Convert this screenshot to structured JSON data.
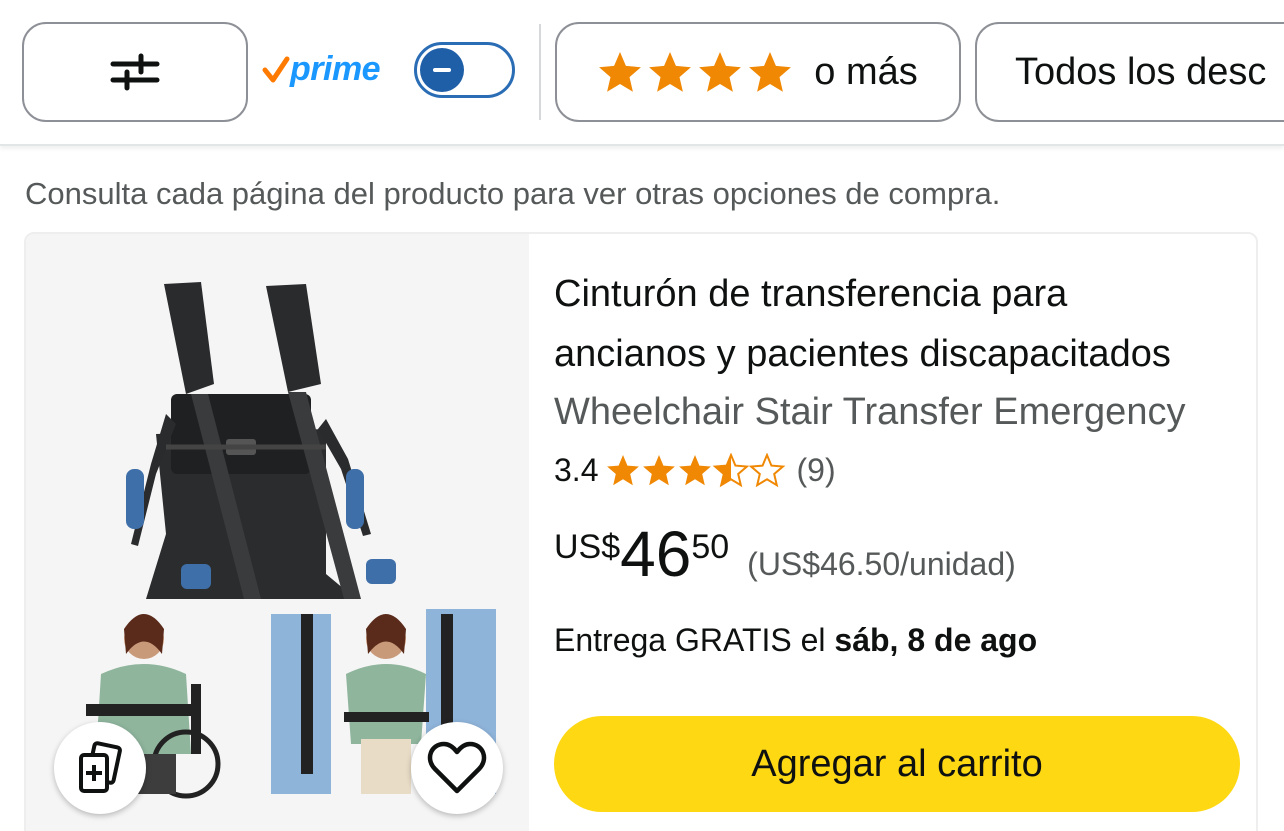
{
  "filter_bar": {
    "filter_icon": "sliders-icon",
    "prime_label": "prime",
    "prime_check_icon": "check-icon",
    "prime_toggle": {
      "on": false,
      "icon": "minus-icon"
    },
    "stars_filter": {
      "stars": 4,
      "label": "o más",
      "star_color": "#f08804"
    },
    "discount_filter": {
      "label": "Todos los desc"
    }
  },
  "notice": "Consulta cada página del producto para ver otras opciones de compra.",
  "product": {
    "title_lines": [
      "Cinturón de transferencia para",
      "ancianos y pacientes discapacitados"
    ],
    "subtitle": "Wheelchair Stair Transfer Emergency",
    "rating": {
      "value": "3.4",
      "stars": 3.5,
      "count": "(9)",
      "star_color": "#f08804"
    },
    "price": {
      "currency": "US$",
      "whole": "46",
      "fraction": "50",
      "unit_price": "(US$46.50/unidad)"
    },
    "delivery": {
      "prefix": "Entrega GRATIS el ",
      "date": "sáb, 8 de ago"
    },
    "add_to_cart": "Agregar al carrito",
    "add_to_cart_color": "#ffd814",
    "images": {
      "main": "wheelchair-transfer-belt-image",
      "thumb_left": "woman-seated-in-wheelchair-image",
      "thumb_right": "nurses-carrying-woman-image"
    },
    "compare_icon": "add-to-compare-icon",
    "wishlist_icon": "heart-icon"
  }
}
